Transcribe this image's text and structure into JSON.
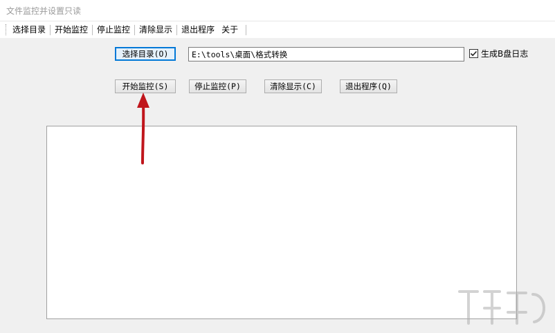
{
  "window": {
    "title": "文件监控并设置只读"
  },
  "menu": {
    "items": [
      {
        "label": "选择目录"
      },
      {
        "label": "开始监控"
      },
      {
        "label": "停止监控"
      },
      {
        "label": "清除显示"
      },
      {
        "label": "退出程序"
      },
      {
        "label": "关于"
      }
    ]
  },
  "form": {
    "choose_dir_button": "选择目录(O)",
    "path_value": "E:\\tools\\桌面\\格式转换",
    "log_checkbox": {
      "label": "生成B盘日志",
      "checked": true
    },
    "start_button": "开始监控(S)",
    "stop_button": "停止监控(P)",
    "clear_button": "清除显示(C)",
    "exit_button": "退出程序(Q)"
  },
  "log": {
    "content": ""
  },
  "colors": {
    "accent": "#0078d7",
    "annotation_arrow": "#c0161c"
  },
  "icons": {
    "annotation": "arrow-up-icon",
    "checkbox": "check-icon",
    "watermark": "xiazaiba-logo"
  }
}
